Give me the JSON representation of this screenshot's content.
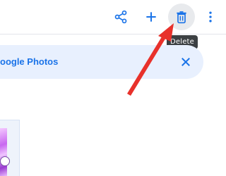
{
  "toolbar": {
    "share_icon": "share-icon",
    "add_icon": "plus-icon",
    "delete_icon": "trash-icon",
    "more_icon": "more-vert-icon",
    "icon_color": "#1a73e8",
    "hover_bg": "#e8eaed"
  },
  "tooltip": {
    "text": "Delete"
  },
  "banner": {
    "text": "oogle Photos",
    "close_icon": "close-icon",
    "background": "#e8f0fe",
    "text_color": "#1a73e8"
  },
  "annotation": {
    "arrow_color": "#e8312b"
  }
}
